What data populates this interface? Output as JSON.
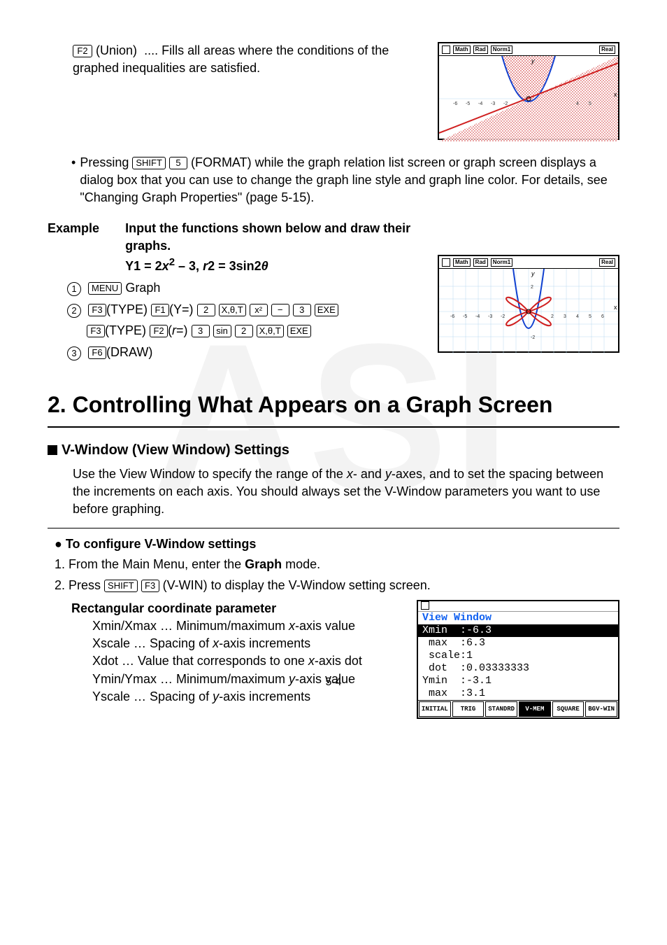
{
  "top": {
    "union_key": "F2",
    "union_label": "(Union)",
    "union_dots": "....",
    "union_desc": "Fills all areas where the conditions of the graphed inequalities are satisfied."
  },
  "note": {
    "lead": "Pressing ",
    "k_shift": "SHIFT",
    "k_5": "5",
    "format": "(FORMAT) while the graph relation list screen or graph screen displays a dialog box that you can use to change the graph line style and graph line color. For details, see \"Changing Graph Properties\" (page 5-15)."
  },
  "example": {
    "label": "Example",
    "title": "Input the functions shown below and draw their graphs.",
    "eq_prefix": "Y1 = 2",
    "eq_mid": " – 3, ",
    "eq_r": "r",
    "eq_tail": "2 = 3sin2",
    "theta": "θ",
    "step1_num": "1",
    "step1_key": "MENU",
    "step1_txt": " Graph",
    "step2_num": "2",
    "s2_keys": [
      "F3",
      "F1",
      "2",
      "X,θ,T",
      "x²",
      "−",
      "3",
      "EXE"
    ],
    "s2_labels": [
      "(TYPE)",
      "(Y=)",
      "",
      "",
      "",
      "",
      "",
      ""
    ],
    "s2b_keys": [
      "F3",
      "F2",
      "3",
      "sin",
      "2",
      "X,θ,T",
      "EXE"
    ],
    "s2b_labels": [
      "(TYPE)",
      "(",
      "r",
      "=)",
      "",
      "",
      "",
      "",
      ""
    ],
    "step3_num": "3",
    "s3_key": "F6",
    "s3_txt": "(DRAW)"
  },
  "section_title": "2. Controlling What Appears on a Graph Screen",
  "vwindow": {
    "heading": "V-Window (View Window) Settings",
    "para": "Use the View Window to specify the range of the ",
    "para2": "- and ",
    "para3": "-axes, and to set the spacing between the increments on each axis. You should always set the V-Window parameters you want to use before graphing.",
    "bullet": "To configure V-Window settings",
    "s1_pre": "1. From the Main Menu, enter the ",
    "s1_bold": "Graph",
    "s1_post": " mode.",
    "s2_pre": "2. Press ",
    "s2_k1": "SHIFT",
    "s2_k2": "F3",
    "s2_post": "(V-WIN) to display the V-Window setting screen.",
    "rect_h": "Rectangular coordinate parameter",
    "p_xmin": "Xmin/Xmax … Minimum/maximum ",
    "p_xmin2": "-axis value",
    "p_xsc": "Xscale … Spacing of ",
    "p_xsc2": "-axis increments",
    "p_xdot": "Xdot … Value that corresponds to one ",
    "p_xdot2": "-axis dot",
    "p_ymin": "Ymin/Ymax … Minimum/maximum ",
    "p_ymin2": "-axis value",
    "p_ysc": "Yscale … Spacing of ",
    "p_ysc2": "-axis increments"
  },
  "vwin_screen": {
    "title": "View Window",
    "l1": "Xmin  :-6.3",
    "l2": " max  :6.3",
    "l3": " scale:1",
    "l4": " dot  :0.03333333",
    "l5": "Ymin  :-3.1",
    "l6": " max  :3.1",
    "f": [
      "INITIAL",
      "TRIG",
      "STANDRD",
      "V-MEM",
      "SQUARE",
      "BGV-WIN"
    ]
  },
  "calc_header": {
    "b1": "Math",
    "b2": "Rad",
    "b3": "Norm1",
    "b4": "Real"
  },
  "pageno": "5-4",
  "watermark": "ASI"
}
